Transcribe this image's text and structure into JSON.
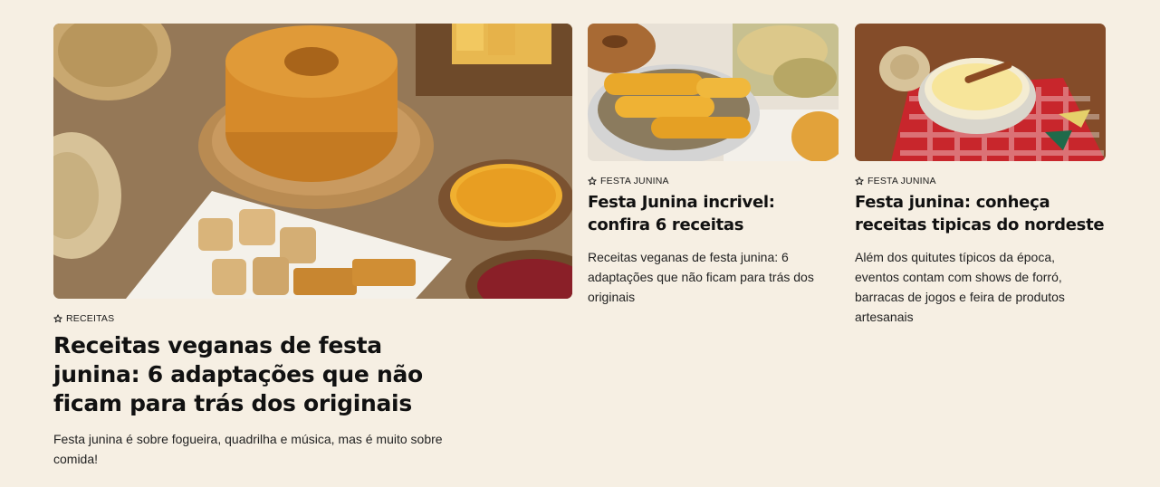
{
  "articles": [
    {
      "tag": "RECEITAS",
      "title": "Receitas veganas de festa junina: 6 adaptações que não ficam para trás dos originais",
      "description": "Festa junina é sobre fogueira, quadrilha e música, mas é muito sobre comida!",
      "image_alt": "Bolo de fubá, milho de pipoca, paçoca e pé de moleque sobre mesa",
      "tag_icon": "star-outline-icon"
    },
    {
      "tag": "FESTA JUNINA",
      "title": "Festa Junina incrivel: confira 6 receitas",
      "description": "Receitas veganas de festa junina: 6 adaptações que não ficam para trás dos originais",
      "image_alt": "Milho cozido em tigela com bolo e pamonhas",
      "tag_icon": "star-outline-icon"
    },
    {
      "tag": "FESTA JUNINA",
      "title": "Festa junina: conheça receitas tipicas do nordeste",
      "description": "Além dos quitutes típicos da época, eventos contam com shows de forró, barracas de jogos e feira de produtos artesanais",
      "image_alt": "Canjica em tigela de vidro com canela sobre toalha xadrez",
      "tag_icon": "star-outline-icon"
    }
  ],
  "colors": {
    "background": "#f6efe3",
    "text": "#111111"
  }
}
